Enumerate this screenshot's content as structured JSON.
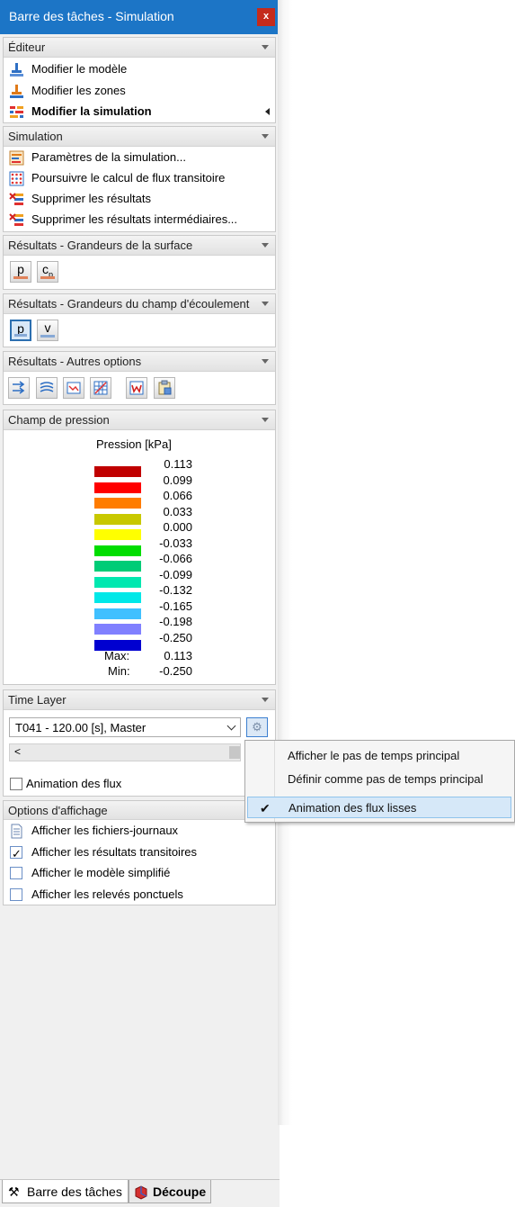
{
  "window": {
    "title": "Barre des tâches - Simulation",
    "close_label": "x"
  },
  "colors": {
    "titlebar": "#1c75c6",
    "close": "#c42b1c",
    "highlight": "#d6e8f8"
  },
  "editeur": {
    "header": "Éditeur",
    "items": [
      {
        "label": "Modifier le modèle",
        "icon": "model-icon"
      },
      {
        "label": "Modifier les zones",
        "icon": "zones-icon"
      },
      {
        "label": "Modifier la simulation",
        "icon": "simulation-icon",
        "active": true
      }
    ]
  },
  "simulation": {
    "header": "Simulation",
    "items": [
      {
        "label": "Paramètres de la simulation...",
        "icon": "settings-icon"
      },
      {
        "label": "Poursuivre le calcul de flux transitoire",
        "icon": "grid-calc-icon"
      },
      {
        "label": "Supprimer les résultats",
        "icon": "delete-results-icon"
      },
      {
        "label": "Supprimer les résultats intermédiaires...",
        "icon": "delete-intermediate-icon"
      }
    ]
  },
  "surface": {
    "header": "Résultats - Grandeurs de la surface",
    "buttons": [
      "p",
      "c",
      "p"
    ]
  },
  "champ": {
    "header": "Résultats - Grandeurs du champ d'écoulement",
    "buttons": [
      "p",
      "v"
    ]
  },
  "autres": {
    "header": "Résultats - Autres options",
    "icons": [
      "streamlines-icon",
      "contours-icon",
      "chart-icon",
      "mesh-icon",
      "report-icon",
      "clipboard-icon"
    ]
  },
  "pression": {
    "header": "Champ de pression",
    "title": "Pression [kPa]",
    "values": [
      "0.113",
      "0.099",
      "0.066",
      "0.033",
      "0.000",
      "-0.033",
      "-0.066",
      "-0.099",
      "-0.132",
      "-0.165",
      "-0.198",
      "-0.250"
    ],
    "colors": [
      "#c00000",
      "#ff0000",
      "#ff7c00",
      "#c8c800",
      "#ffff00",
      "#00dd00",
      "#00cc77",
      "#00e8b0",
      "#00e8e8",
      "#40c0ff",
      "#8080ff",
      "#0000d0"
    ],
    "max_label": "Max:",
    "max_value": "0.113",
    "min_label": "Min:",
    "min_value": "-0.250"
  },
  "timelayer": {
    "header": "Time Layer",
    "selected": "T041 - 120.00 [s], Master",
    "scroll_left": "<",
    "animation_label": "Animation des flux",
    "animation_checked": false
  },
  "context_menu": {
    "items": [
      {
        "label": "Afficher le pas de temps principal",
        "checked": false
      },
      {
        "label": "Définir comme pas de temps principal",
        "checked": false
      },
      {
        "label": "Animation des flux lisses",
        "checked": true
      }
    ],
    "check_glyph": "✔"
  },
  "options": {
    "header": "Options d'affichage",
    "items": [
      {
        "label": "Afficher les fichiers-journaux",
        "kind": "icon"
      },
      {
        "label": "Afficher les résultats transitoires",
        "kind": "checkbox",
        "checked": true
      },
      {
        "label": "Afficher le modèle simplifié",
        "kind": "checkbox",
        "checked": false
      },
      {
        "label": "Afficher les relevés ponctuels",
        "kind": "checkbox",
        "checked": false
      }
    ]
  },
  "tabs": [
    {
      "label": "Barre des tâches",
      "icon": "tools-icon",
      "active": true
    },
    {
      "label": "Découpe",
      "icon": "clipping-icon",
      "active": false
    }
  ]
}
